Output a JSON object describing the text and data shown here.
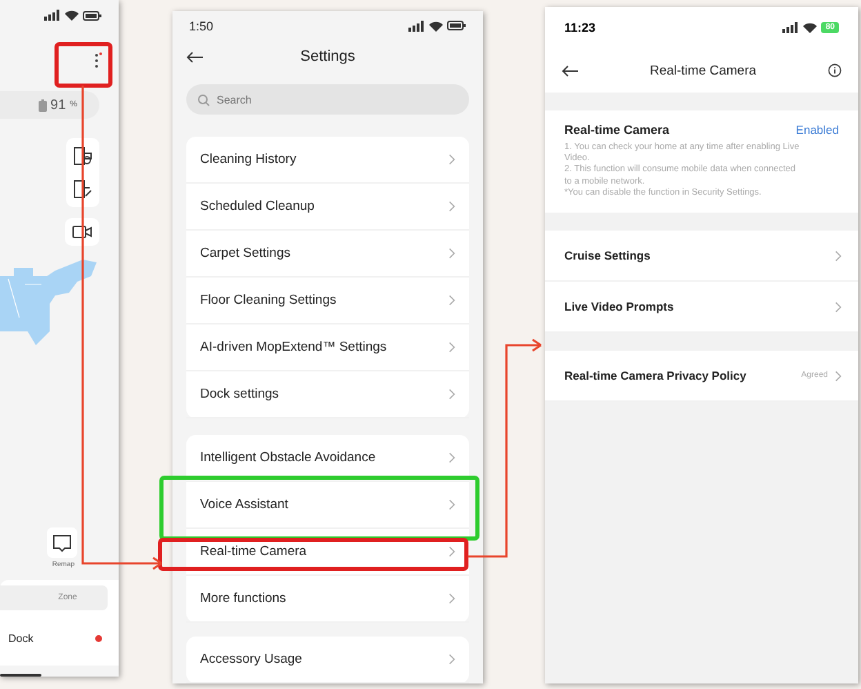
{
  "map_screen": {
    "battery": "91",
    "battery_unit": "%",
    "remap_label": "Remap",
    "tabs": [
      {
        "label": "Zone",
        "selected": false
      }
    ],
    "dock": {
      "label": "Dock",
      "color": "#e53935"
    }
  },
  "settings_screen": {
    "time": "1:50",
    "title": "Settings",
    "search": {
      "placeholder": "Search"
    },
    "groups": [
      {
        "items": [
          "Cleaning History",
          "Scheduled Cleanup",
          "Carpet Settings",
          "Floor Cleaning Settings",
          "AI-driven MopExtend™ Settings",
          "Dock settings"
        ]
      },
      {
        "items": [
          "Intelligent Obstacle Avoidance",
          "Voice Assistant",
          "Real-time Camera",
          "More functions"
        ]
      },
      {
        "items": [
          "Accessory Usage"
        ]
      }
    ]
  },
  "camera_screen": {
    "time": "11:23",
    "battery": "80",
    "title": "Real-time Camera",
    "feature": {
      "title": "Real-time Camera",
      "status": "Enabled",
      "notes": [
        "1. You can check your home at any time after enabling Live Video.",
        "2. This function will consume mobile data when connected to a mobile network.",
        "*You can disable the function in Security Settings."
      ]
    },
    "rows": [
      {
        "label": "Cruise Settings"
      },
      {
        "label": "Live Video Prompts"
      }
    ],
    "policy": {
      "label": "Real-time Camera Privacy Policy",
      "status": "Agreed"
    }
  },
  "annotations": {
    "highlights": [
      {
        "color": "#e02020"
      },
      {
        "color": "#2ecc2e"
      },
      {
        "color": "#e02020"
      }
    ]
  }
}
